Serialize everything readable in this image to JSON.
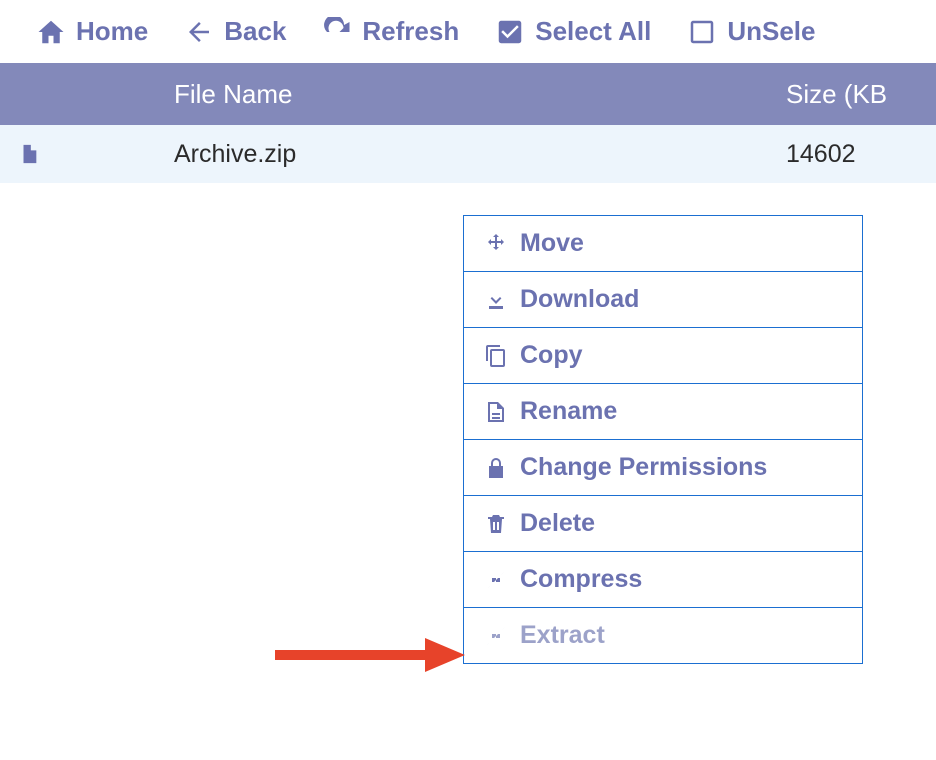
{
  "toolbar": {
    "home": "Home",
    "back": "Back",
    "refresh": "Refresh",
    "select_all": "Select All",
    "unselect": "UnSele"
  },
  "headers": {
    "name": "File Name",
    "size": "Size (KB"
  },
  "row": {
    "name": "Archive.zip",
    "size": "14602"
  },
  "menu": {
    "move": "Move",
    "download": "Download",
    "copy": "Copy",
    "rename": "Rename",
    "perms": "Change Permissions",
    "delete": "Delete",
    "compress": "Compress",
    "extract": "Extract"
  }
}
